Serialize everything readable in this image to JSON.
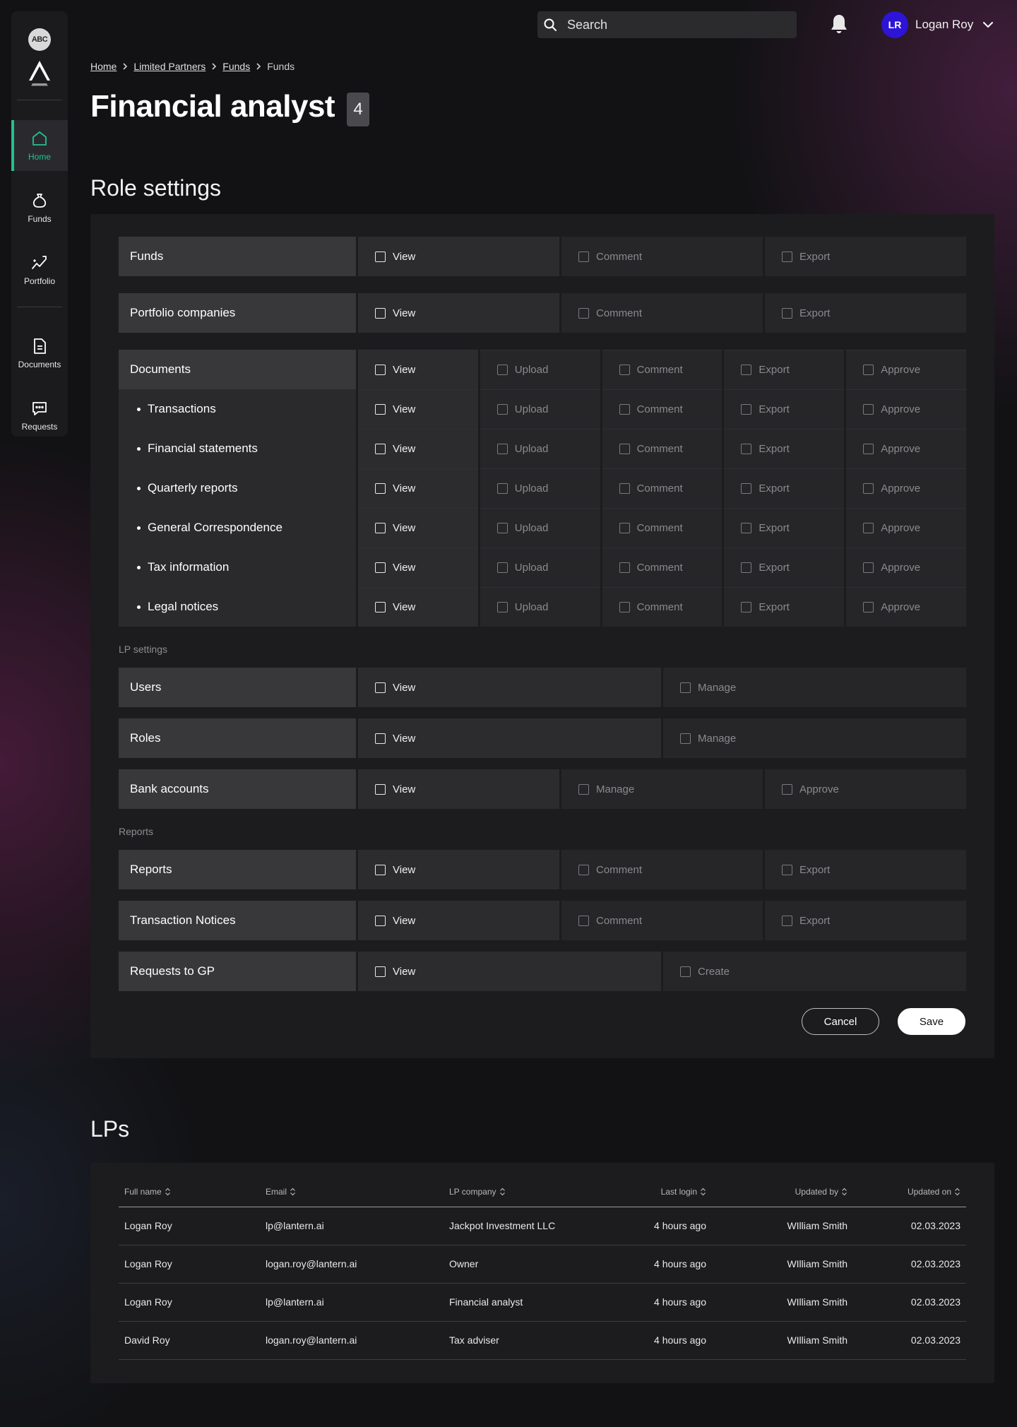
{
  "sidebar": {
    "logo_text": "ABC",
    "items": [
      {
        "label": "Home",
        "icon": "home-icon",
        "active": true
      },
      {
        "label": "Funds",
        "icon": "funds-icon"
      },
      {
        "label": "Portfolio",
        "icon": "portfolio-icon"
      },
      {
        "label": "Documents",
        "icon": "document-icon"
      },
      {
        "label": "Requests",
        "icon": "chat-icon"
      }
    ]
  },
  "header": {
    "search_placeholder": "Search",
    "user_initials": "LR",
    "user_name": "Logan Roy"
  },
  "breadcrumb": [
    "Home",
    "Limited Partners",
    "Funds",
    "Funds"
  ],
  "page": {
    "title": "Financial analyst",
    "badge": "4",
    "role_settings_title": "Role settings",
    "lps_title": "LPs"
  },
  "role_settings": {
    "funds": {
      "label": "Funds",
      "actions": [
        "View",
        "Comment",
        "Export"
      ]
    },
    "portfolio": {
      "label": "Portfolio companies",
      "actions": [
        "View",
        "Comment",
        "Export"
      ]
    },
    "documents": {
      "label": "Documents",
      "actions": [
        "View",
        "Upload",
        "Comment",
        "Export",
        "Approve"
      ],
      "subs": [
        "Transactions",
        "Financial statements",
        "Quarterly reports",
        "General Correspondence",
        "Tax information",
        "Legal notices"
      ]
    },
    "lp_settings_label": "LP settings",
    "users": {
      "label": "Users",
      "actions": [
        "View",
        "Manage"
      ]
    },
    "roles": {
      "label": "Roles",
      "actions": [
        "View",
        "Manage"
      ]
    },
    "bank_accounts": {
      "label": "Bank accounts",
      "actions": [
        "View",
        "Manage",
        "Approve"
      ]
    },
    "reports_label": "Reports",
    "reports": {
      "label": "Reports",
      "actions": [
        "View",
        "Comment",
        "Export"
      ]
    },
    "transaction_notices": {
      "label": "Transaction Notices",
      "actions": [
        "View",
        "Comment",
        "Export"
      ]
    },
    "requests_gp": {
      "label": "Requests to GP",
      "actions": [
        "View",
        "Create"
      ]
    },
    "cancel_label": "Cancel",
    "save_label": "Save"
  },
  "lps": {
    "columns": [
      "Full name",
      "Email",
      "LP company",
      "Last login",
      "Updated by",
      "Updated on"
    ],
    "rows": [
      [
        "Logan  Roy",
        "lp@lantern.ai",
        "Jackpot Investment LLC",
        "4 hours ago",
        "WIlliam Smith",
        "02.03.2023"
      ],
      [
        "Logan  Roy",
        "logan.roy@lantern.ai",
        "Owner",
        "4 hours ago",
        "WIlliam Smith",
        "02.03.2023"
      ],
      [
        "Logan  Roy",
        "lp@lantern.ai",
        "Financial analyst",
        "4 hours ago",
        "WIlliam Smith",
        "02.03.2023"
      ],
      [
        "David Roy",
        "logan.roy@lantern.ai",
        "Tax adviser",
        "4 hours ago",
        "WIlliam Smith",
        "02.03.2023"
      ]
    ]
  },
  "colors": {
    "accent": "#21c28e",
    "avatar": "#2d14d6",
    "background": "#121214",
    "panel": "#1c1c1e"
  }
}
